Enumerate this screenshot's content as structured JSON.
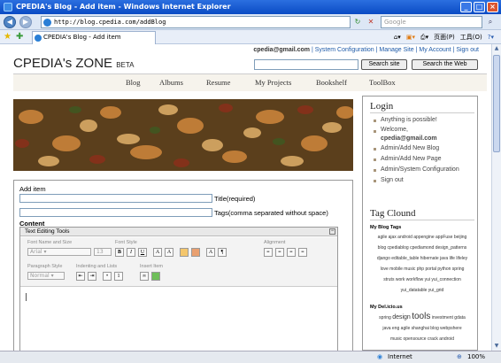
{
  "window": {
    "title": "CPEDIA's Blog - Add item - Windows Internet Explorer"
  },
  "address": {
    "url": "http://blog.cpedia.com/addBlog",
    "search_placeholder": "Google"
  },
  "tab": {
    "label": "CPEDIA's Blog - Add item"
  },
  "commandbar": {
    "page": "页面(P)",
    "tools": "工具(O)"
  },
  "header": {
    "email": "cpedia@gmail.com",
    "links": [
      "System Configuration",
      "Manage Site",
      "My Account",
      "Sign out"
    ],
    "title": "CPEDIA's ZONE",
    "beta": "BETA",
    "search_site": "Search site",
    "search_web": "Search the Web"
  },
  "nav": [
    "Blog",
    "Albums",
    "Resume",
    "My Projects",
    "Bookshelf",
    "ToolBox"
  ],
  "form": {
    "add_item": "Add item",
    "title_label": "Title",
    "title_note": "(required)",
    "tags_label": "Tags",
    "tags_note": "(comma separated without space)",
    "content_label": "Content"
  },
  "editor": {
    "header": "Text Editing Tools",
    "font_group": "Font Name and Size",
    "font_name": "Arial",
    "font_size": "13",
    "style_group": "Font Style",
    "align_group": "Alignment",
    "para_group": "Paragraph Style",
    "para_value": "Normal",
    "indent_group": "Indenting and Lists",
    "insert_group": "Insert Item"
  },
  "sidebar": {
    "login_title": "Login",
    "login_items": [
      "Anything is possible!",
      "Welcome,",
      "Admin/Add New Blog",
      "Admin/Add New Page",
      "Admin/System Configuration",
      "Sign out"
    ],
    "welcome_email": "cpedia@gmail.com",
    "tagcloud_title": "Tag Clound",
    "blog_tags_title": "My Blog Tags",
    "blog_tags_1": "agile ajax android appengine appFuse beijing",
    "blog_tags_2": "blog cpediablog cpediamond design_patterns",
    "blog_tags_3": "django editable_table hibernate java life lifeley",
    "blog_tags_4": "love mobile music php portal python spring",
    "blog_tags_5": "struts work workflow yui yui_connection",
    "blog_tags_6": "yui_datatable yui_grid",
    "delicious_title": "My Del.icio.us",
    "del_small_1": "spring",
    "del_md_1": "design",
    "del_big": "tools",
    "del_small_2": "investment gdata",
    "del_tags_2": "java eng agile shanghai blog webpshere",
    "del_tags_3": "music opensource crack android"
  },
  "status": {
    "zone": "Internet",
    "zoom": "100%"
  }
}
